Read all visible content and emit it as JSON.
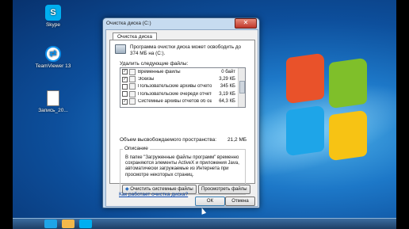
{
  "desktop": {
    "icons": [
      {
        "label": "Skype",
        "icon": "skype-icon",
        "color": "#00aff0",
        "glyph": "S"
      },
      {
        "label": "TeamViewer 13",
        "icon": "teamviewer-icon",
        "color": "#0e8ee9",
        "glyph": "⇄"
      },
      {
        "label": "Запись_20...",
        "icon": "document-icon",
        "color": "#ffffff",
        "glyph": ""
      }
    ]
  },
  "dialog": {
    "title": "Очистка диска  (C:)",
    "tab": "Очистка диска",
    "summary": "Программа очистки диска может освободить до 374 МБ на  (C:).",
    "delete_label": "Удалить следующие файлы:",
    "files": [
      {
        "checked": true,
        "name": "Временные файлы",
        "size": "0 байт"
      },
      {
        "checked": true,
        "name": "Эскизы",
        "size": "3,29 КБ"
      },
      {
        "checked": false,
        "name": "Пользовательские архивы отчетов ...",
        "size": "345 КБ"
      },
      {
        "checked": false,
        "name": "Пользовательские очереди отчетов ...",
        "size": "3,19 КБ"
      },
      {
        "checked": true,
        "name": "Системные архивы отчетов об ошиб...",
        "size": "64,3 КБ"
      }
    ],
    "total_label": "Объем высвобождаемого пространства:",
    "total_value": "21,2 МБ",
    "description_title": "Описание",
    "description_text": "В папке \"Загруженные файлы программ\" временно сохраняются элементы ActiveX и приложения Java, автоматически загружаемые из Интернета при просмотре некоторых страниц.",
    "clean_system_button": "Очистить системные файлы",
    "view_files_button": "Просмотреть файлы",
    "help_link": "Как работает очистка диска?",
    "ok_button": "ОК",
    "cancel_button": "Отмена"
  }
}
